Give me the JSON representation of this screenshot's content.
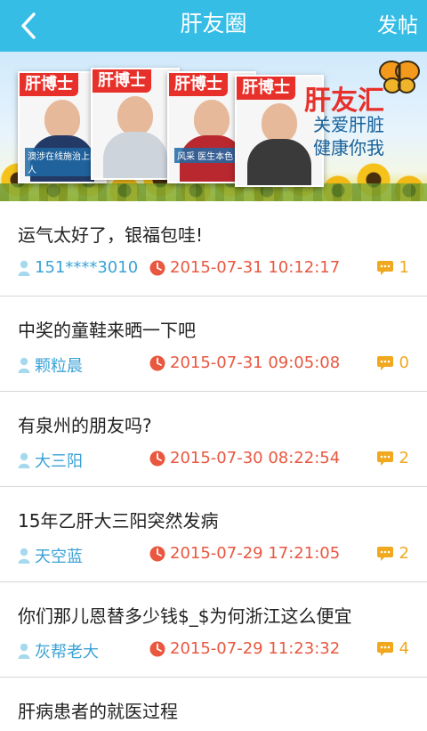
{
  "header": {
    "title": "肝友圈",
    "post_label": "发帖"
  },
  "banner": {
    "magazine_title": "肝博士",
    "cover_tags": [
      "澳涉在线施治上的人",
      "",
      "风采  医生本色",
      ""
    ],
    "brand_main": "肝友汇",
    "brand_sub1": "关爱肝脏",
    "brand_sub2": "健康你我",
    "active_dot": 0
  },
  "posts": [
    {
      "title": "运气太好了，银福包哇!",
      "author": "151****3010",
      "time": "2015-07-31 10:12:17",
      "comments": "1"
    },
    {
      "title": "中奖的童鞋来晒一下吧",
      "author": "颗粒晨",
      "time": "2015-07-31 09:05:08",
      "comments": "0"
    },
    {
      "title": "有泉州的朋友吗?",
      "author": "大三阳",
      "time": "2015-07-30 08:22:54",
      "comments": "2"
    },
    {
      "title": "15年乙肝大三阳突然发病",
      "author": "天空蓝",
      "time": "2015-07-29 17:21:05",
      "comments": "2"
    },
    {
      "title": "你们那儿恩替多少钱$_$为何浙江这么便宜",
      "author": "灰帮老大",
      "time": "2015-07-29 11:23:32",
      "comments": "4"
    },
    {
      "title": "肝病患者的就医过程"
    }
  ],
  "colors": {
    "header_bg": "#35bde6",
    "author": "#3aa2d6",
    "time": "#e9573f",
    "comments": "#f0a81e",
    "brand_red": "#e8302a",
    "brand_blue": "#17619b"
  }
}
